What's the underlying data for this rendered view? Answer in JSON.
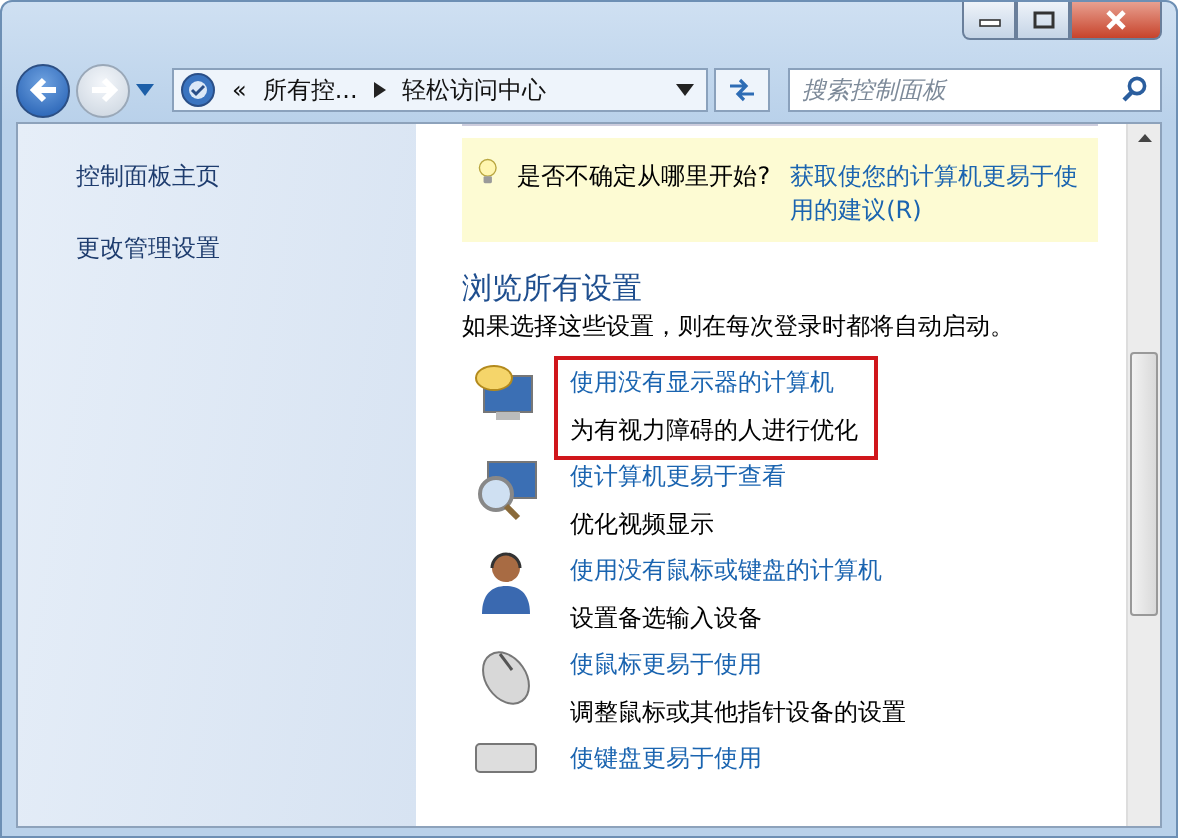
{
  "nav": {
    "back": {
      "disabled": false
    },
    "forward": {
      "disabled": true
    }
  },
  "address": {
    "crumbs": [
      "«",
      "所有控...",
      "轻松访问中心"
    ]
  },
  "search": {
    "placeholder": "搜索控制面板"
  },
  "sidebar": {
    "items": [
      {
        "label": "控制面板主页"
      },
      {
        "label": "更改管理设置"
      }
    ]
  },
  "tip": {
    "text": "是否不确定从哪里开始?",
    "link": "获取使您的计算机更易于使用的建议(R)"
  },
  "section": {
    "title": "浏览所有设置",
    "description": "如果选择这些设置，则在每次登录时都将自动启动。"
  },
  "items": [
    {
      "kind": "monitor",
      "title": "使用没有显示器的计算机",
      "description": "为有视力障碍的人进行优化",
      "highlighted": true
    },
    {
      "kind": "magnifier",
      "title": "使计算机更易于查看",
      "description": "优化视频显示",
      "highlighted": false
    },
    {
      "kind": "person",
      "title": "使用没有鼠标或键盘的计算机",
      "description": "设置备选输入设备",
      "highlighted": false
    },
    {
      "kind": "mouse",
      "title": "使鼠标更易于使用",
      "description": "调整鼠标或其他指针设备的设置",
      "highlighted": false
    },
    {
      "kind": "keyboard",
      "title": "使键盘更易于使用",
      "highlighted": false
    }
  ]
}
